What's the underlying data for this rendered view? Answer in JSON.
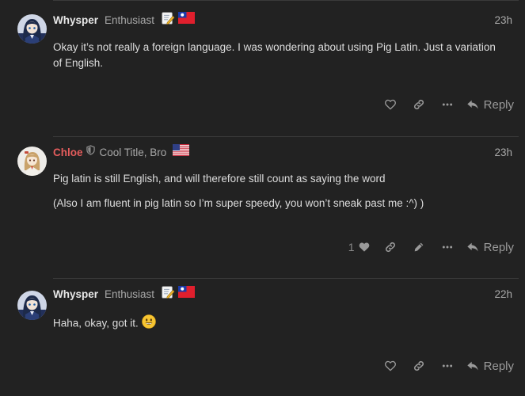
{
  "colors": {
    "background": "#222222",
    "text": "#dddddd",
    "muted": "#a8a8a8",
    "icon": "#9a9a9a",
    "chloe_name": "#e45c5c",
    "whysper_name": "#e8e8e8"
  },
  "posts": [
    {
      "username": "Whysper",
      "user_title": "Enthusiast",
      "time": "23h",
      "paragraphs": [
        "Okay it’s not really a foreign language. I was wondering about using Pig Latin. Just a variation of English."
      ],
      "reply_label": "Reply",
      "icons": [
        "heart-icon",
        "link-icon",
        "more-icon",
        "reply-icon"
      ]
    },
    {
      "username": "Chloe",
      "user_title": "Cool Title, Bro",
      "time": "23h",
      "paragraphs": [
        "Pig latin is still English, and will therefore still count as saying the word",
        "(Also I am fluent in pig latin so I’m super speedy, you won’t sneak past me :^) )"
      ],
      "like_count": "1",
      "reply_label": "Reply",
      "icons": [
        "heart-icon",
        "link-icon",
        "pencil-icon",
        "more-icon",
        "reply-icon"
      ]
    },
    {
      "username": "Whysper",
      "user_title": "Enthusiast",
      "time": "22h",
      "paragraphs": [
        "Haha, okay, got it."
      ],
      "reply_label": "Reply",
      "icons": [
        "heart-icon",
        "link-icon",
        "more-icon",
        "reply-icon"
      ]
    }
  ]
}
